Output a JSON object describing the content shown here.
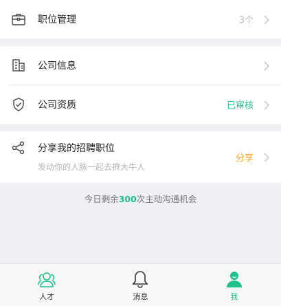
{
  "menu": {
    "job_management": {
      "label": "职位管理",
      "value": "3个"
    },
    "company_info": {
      "label": "公司信息",
      "value": ""
    },
    "company_qualification": {
      "label": "公司资质",
      "value": "已审核"
    },
    "share_jobs": {
      "label": "分享我的招聘职位",
      "subtitle": "发动你的人脉一起去撩大牛人",
      "value": "分享"
    }
  },
  "chance_text": {
    "prefix": "今日剩余",
    "count": "300",
    "suffix": "次主动沟通机会"
  },
  "tabbar": {
    "tabs": [
      {
        "label": "人才",
        "icon": "people-icon"
      },
      {
        "label": "消息",
        "icon": "bell-icon"
      },
      {
        "label": "我",
        "icon": "profile-icon"
      }
    ],
    "active_index": 2
  },
  "colors": {
    "accent_green": "#20c08d",
    "share_orange": "#f5a623",
    "muted_gray": "#b5b5b5"
  }
}
